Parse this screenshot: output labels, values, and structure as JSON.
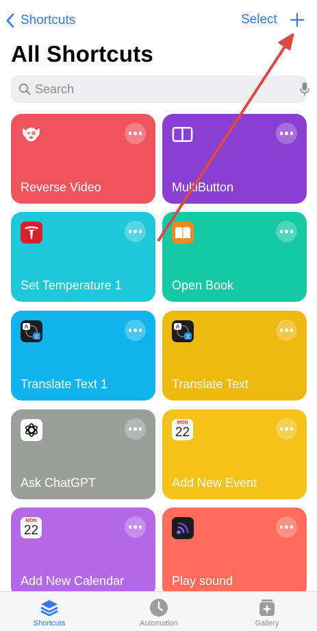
{
  "nav": {
    "back_label": "Shortcuts",
    "select_label": "Select",
    "add_icon": "plus-icon"
  },
  "page_title": "All Shortcuts",
  "search": {
    "placeholder": "Search"
  },
  "shortcuts": [
    {
      "label": "Reverse Video",
      "color": "#f0545c",
      "icon": "dog-face-icon"
    },
    {
      "label": "MultiButton",
      "color": "#8a3fd0",
      "icon": "split-panel-icon"
    },
    {
      "label": "Set Temperature 1",
      "color": "#1ec8d8",
      "icon": "tesla-icon"
    },
    {
      "label": "Open Book",
      "color": "#16c9a6",
      "icon": "books-icon"
    },
    {
      "label": "Translate Text 1",
      "color": "#11b3ef",
      "icon": "translate-icon"
    },
    {
      "label": "Translate Text",
      "color": "#eeb90f",
      "icon": "translate-icon"
    },
    {
      "label": "Ask ChatGPT",
      "color": "#9a9f9c",
      "icon": "chatgpt-icon"
    },
    {
      "label": "Add New Event",
      "color": "#f3c317",
      "icon": "calendar-icon",
      "cal_month": "MON",
      "cal_day": "22"
    },
    {
      "label": "Add New Calendar",
      "color": "#b469e6",
      "icon": "calendar-icon",
      "cal_month": "MON",
      "cal_day": "22"
    },
    {
      "label": "Play sound",
      "color": "#ff6c5b",
      "icon": "sound-wave-icon"
    }
  ],
  "tabbar": {
    "tabs": [
      {
        "label": "Shortcuts",
        "icon": "stack-layers-icon",
        "active": true
      },
      {
        "label": "Automation",
        "icon": "clock-icon",
        "active": false
      },
      {
        "label": "Gallery",
        "icon": "sparkle-square-icon",
        "active": false
      }
    ]
  },
  "colors": {
    "accent": "#3478f6",
    "annotation_arrow": "#dd4a43",
    "inactive_tab": "#8e8e93"
  }
}
